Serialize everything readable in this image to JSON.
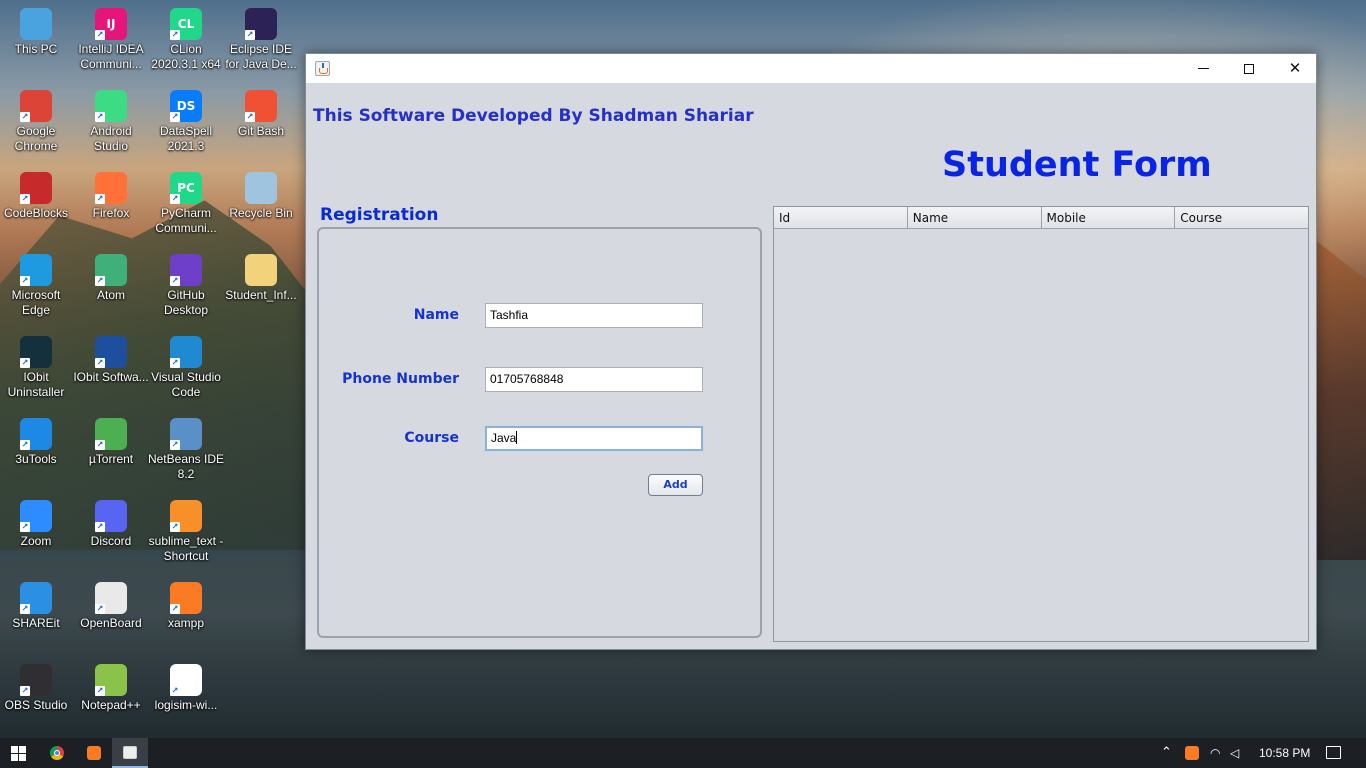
{
  "desktop": {
    "icons": [
      {
        "label": "This PC",
        "icon": "computer-icon",
        "color": "#4aa3df"
      },
      {
        "label": "IntelliJ IDEA Communi...",
        "icon": "intellij-icon",
        "color": "#e6157a",
        "glyph": "IJ"
      },
      {
        "label": "CLion 2020.3.1 x64",
        "icon": "clion-icon",
        "color": "#21d789",
        "glyph": "CL"
      },
      {
        "label": "Eclipse IDE for Java De...",
        "icon": "eclipse-icon",
        "color": "#2c2255"
      },
      {
        "label": "Google Chrome",
        "icon": "chrome-icon",
        "color": "#db4437"
      },
      {
        "label": "Android Studio",
        "icon": "android-studio-icon",
        "color": "#3ddc84"
      },
      {
        "label": "DataSpell 2021.3",
        "icon": "dataspell-icon",
        "color": "#087cfa",
        "glyph": "DS"
      },
      {
        "label": "Git Bash",
        "icon": "git-bash-icon",
        "color": "#f05033"
      },
      {
        "label": "CodeBlocks",
        "icon": "codeblocks-icon",
        "color": "#c62a2a"
      },
      {
        "label": "Firefox",
        "icon": "firefox-icon",
        "color": "#ff7139"
      },
      {
        "label": "PyCharm Communi...",
        "icon": "pycharm-icon",
        "color": "#21d789",
        "glyph": "PC"
      },
      {
        "label": "Recycle Bin",
        "icon": "recycle-bin-icon",
        "color": "#9fc4e0"
      },
      {
        "label": "Microsoft Edge",
        "icon": "edge-icon",
        "color": "#1e9be0"
      },
      {
        "label": "Atom",
        "icon": "atom-icon",
        "color": "#3fb07a"
      },
      {
        "label": "GitHub Desktop",
        "icon": "github-desktop-icon",
        "color": "#6e40c9"
      },
      {
        "label": "Student_Inf...",
        "icon": "folder-icon",
        "color": "#f2d27a"
      },
      {
        "label": "IObit Uninstaller",
        "icon": "iobit-uninstaller-icon",
        "color": "#14303d"
      },
      {
        "label": "IObit Softwa...",
        "icon": "iobit-software-icon",
        "color": "#1e4f9e"
      },
      {
        "label": "Visual Studio Code",
        "icon": "vscode-icon",
        "color": "#1f8ad2"
      },
      {
        "label": "3uTools",
        "icon": "3utools-icon",
        "color": "#1e88e5"
      },
      {
        "label": "µTorrent",
        "icon": "utorrent-icon",
        "color": "#4caf50"
      },
      {
        "label": "NetBeans IDE 8.2",
        "icon": "netbeans-icon",
        "color": "#5b8fc7"
      },
      {
        "label": "Zoom",
        "icon": "zoom-icon",
        "color": "#2d8cff"
      },
      {
        "label": "Discord",
        "icon": "discord-icon",
        "color": "#5865f2"
      },
      {
        "label": "sublime_text - Shortcut",
        "icon": "sublime-text-icon",
        "color": "#f98f29"
      },
      {
        "label": "SHAREit",
        "icon": "shareit-icon",
        "color": "#2b8fe3"
      },
      {
        "label": "OpenBoard",
        "icon": "openboard-icon",
        "color": "#e9e9e9"
      },
      {
        "label": "xampp",
        "icon": "xampp-icon",
        "color": "#fb7a24"
      },
      {
        "label": "OBS Studio",
        "icon": "obs-icon",
        "color": "#302e31"
      },
      {
        "label": "Notepad++",
        "icon": "notepadpp-icon",
        "color": "#8bc34a"
      },
      {
        "label": "logisim-wi...",
        "icon": "logisim-icon",
        "color": "#ffffff"
      }
    ]
  },
  "window": {
    "app_icon": "java-icon",
    "developer_credit": "This Software Developed By Shadman Shariar",
    "form_title": "Student Form",
    "registration": {
      "title": "Registration",
      "name_label": "Name",
      "name_value": "Tashfia",
      "phone_label": "Phone Number",
      "phone_value": "01705768848",
      "course_label": "Course",
      "course_value": "Java",
      "add_button": "Add"
    },
    "table": {
      "columns": [
        "Id",
        "Name",
        "Mobile",
        "Course"
      ],
      "rows": []
    }
  },
  "taskbar": {
    "items": [
      {
        "icon": "windows-start-icon"
      },
      {
        "icon": "chrome-icon",
        "color": "#db4437"
      },
      {
        "icon": "xampp-icon",
        "color": "#fb7a24"
      },
      {
        "icon": "java-icon",
        "active": true
      }
    ],
    "tray": {
      "time": "10:58 PM"
    }
  }
}
